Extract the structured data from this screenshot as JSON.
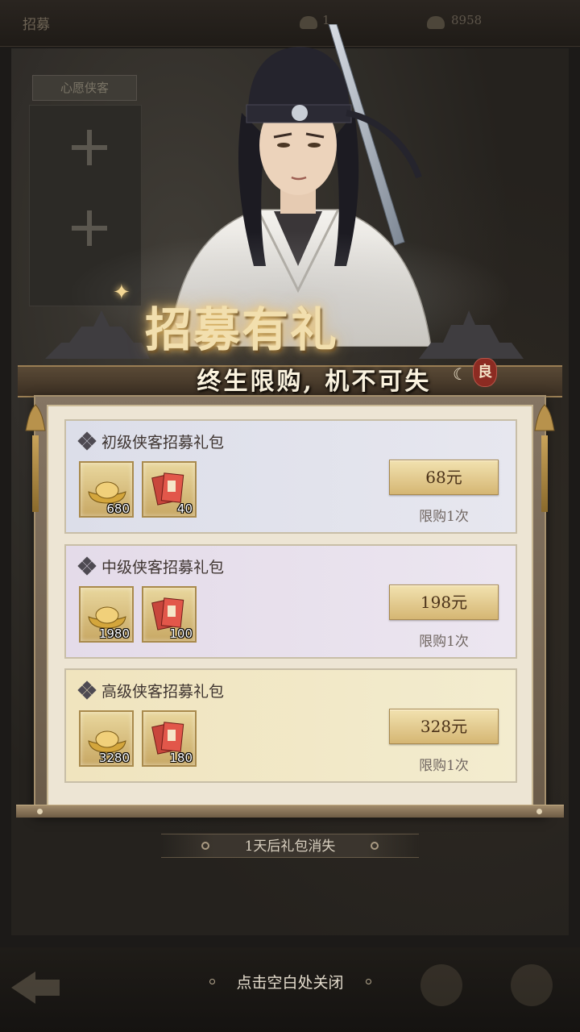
{
  "background": {
    "screen_title": "招募",
    "resource_1": "1",
    "resource_2": "8958",
    "panel_tag": "心愿侠客"
  },
  "banner": {
    "title": "招募有礼",
    "subtitle": "终生限购, 机不可失",
    "seal": "良"
  },
  "packs": [
    {
      "title": "初级侠客招募礼包",
      "items": [
        {
          "icon": "gold-ingot-icon",
          "qty": "680"
        },
        {
          "icon": "recruit-letter-icon",
          "qty": "40"
        }
      ],
      "price": "68元",
      "limit": "限购1次",
      "tint": "#dcdee9"
    },
    {
      "title": "中级侠客招募礼包",
      "items": [
        {
          "icon": "gold-ingot-icon",
          "qty": "1980"
        },
        {
          "icon": "recruit-letter-icon",
          "qty": "100"
        }
      ],
      "price": "198元",
      "limit": "限购1次",
      "tint": "#e4dbe9"
    },
    {
      "title": "高级侠客招募礼包",
      "items": [
        {
          "icon": "gold-ingot-icon",
          "qty": "3280"
        },
        {
          "icon": "recruit-letter-icon",
          "qty": "180"
        }
      ],
      "price": "328元",
      "limit": "限购1次",
      "tint": "#f0e4be"
    }
  ],
  "timer": "1天后礼包消失",
  "close_hint": "点击空白处关闭",
  "colors": {
    "gold_button": "#d5b673",
    "seal_red": "#8c2b22",
    "frame": "#6a5b49"
  }
}
